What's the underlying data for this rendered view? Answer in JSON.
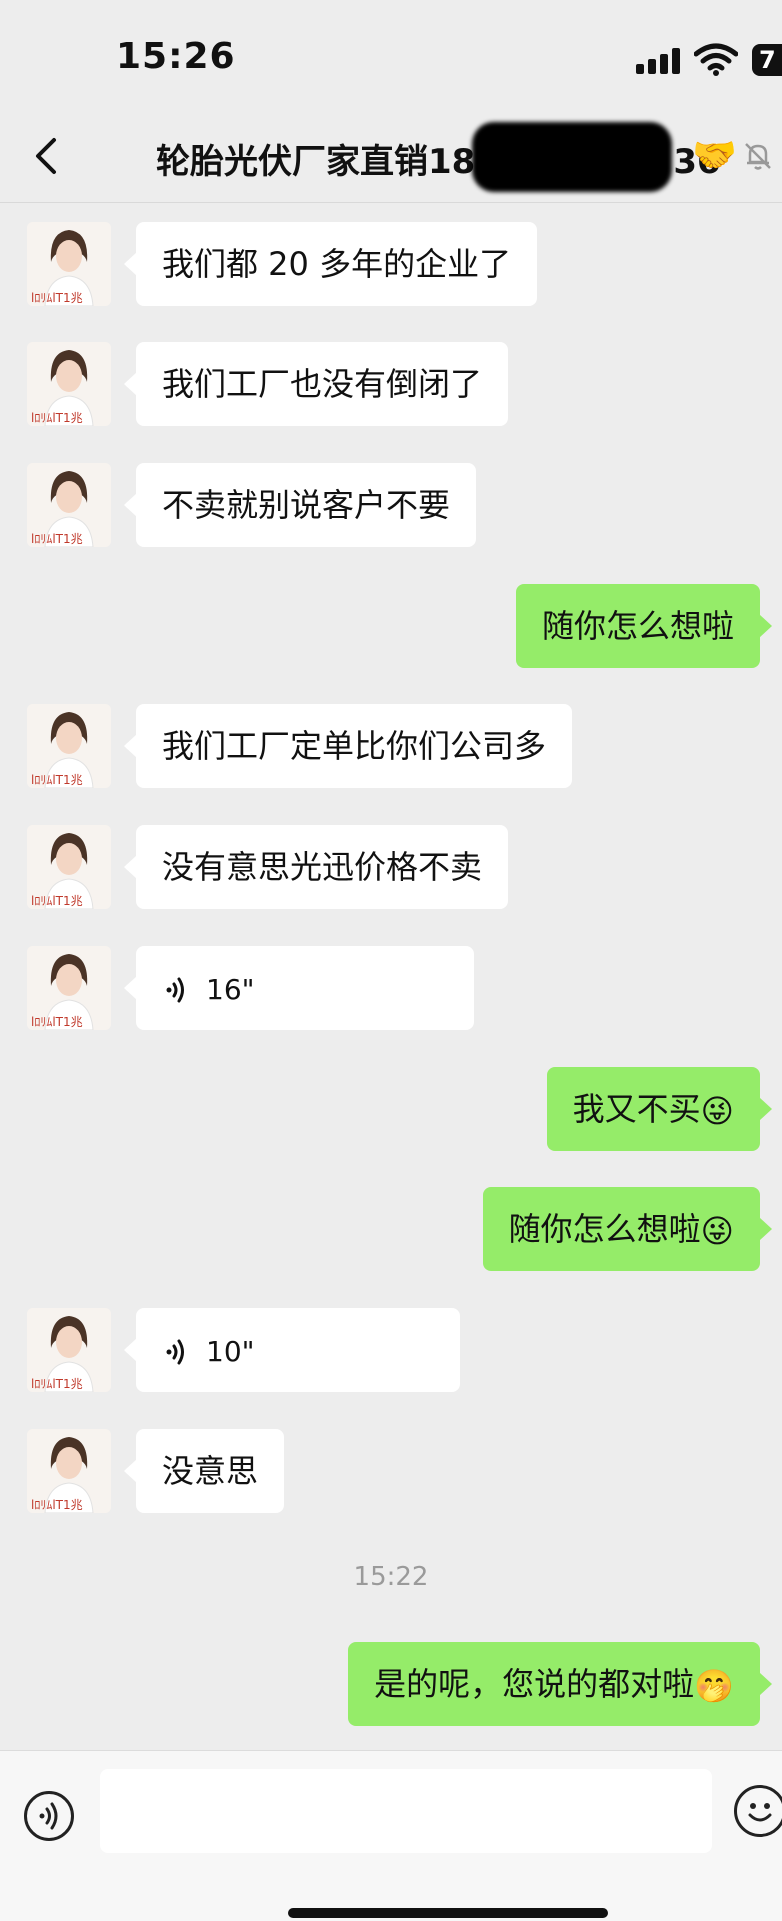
{
  "status_bar": {
    "time": "15:26",
    "battery": "7"
  },
  "header": {
    "title": "轮胎光伏厂家直销18",
    "title_tail": "36",
    "title_emoji": "🤝"
  },
  "messages": [
    {
      "side": "in",
      "type": "text",
      "text": "我们都 20 多年的企业了"
    },
    {
      "side": "in",
      "type": "text",
      "text": "我们工厂也没有倒闭了"
    },
    {
      "side": "in",
      "type": "text",
      "text": "不卖就别说客户不要"
    },
    {
      "side": "out",
      "type": "text",
      "text": "随你怎么想啦"
    },
    {
      "side": "in",
      "type": "text",
      "text": "我们工厂定单比你们公司多"
    },
    {
      "side": "in",
      "type": "text",
      "text": "没有意思光迅价格不卖"
    },
    {
      "side": "in",
      "type": "voice",
      "duration": "16\""
    },
    {
      "side": "out",
      "type": "text",
      "text": "我又不买",
      "emoji": "😜"
    },
    {
      "side": "out",
      "type": "text",
      "text": "随你怎么想啦",
      "emoji": "😜"
    },
    {
      "side": "in",
      "type": "voice",
      "duration": "10\""
    },
    {
      "side": "in",
      "type": "text",
      "text": "没意思"
    },
    {
      "type": "timestamp",
      "text": "15:22"
    },
    {
      "side": "out",
      "type": "text",
      "text": "是的呢，您说的都对啦",
      "emoji": "🤭"
    }
  ],
  "input_bar": {
    "placeholder": ""
  },
  "colors": {
    "background": "#ededed",
    "incoming_bubble": "#ffffff",
    "outgoing_bubble": "#95ec69"
  }
}
